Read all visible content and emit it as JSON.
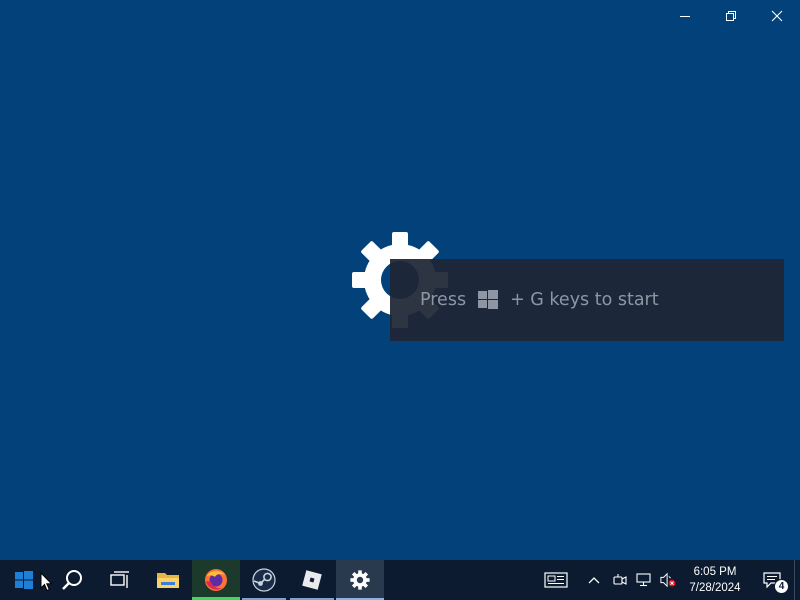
{
  "window": {
    "controls": [
      "minimize",
      "restore",
      "close"
    ]
  },
  "splash": {
    "icon": "gear-icon",
    "hint_prefix": "Press",
    "hint_key_icon": "windows-logo-icon",
    "hint_suffix": "+ G keys to start"
  },
  "taskbar": {
    "start_icon": "windows-start-icon",
    "items": [
      {
        "name": "search",
        "icon": "search-icon"
      },
      {
        "name": "task-view",
        "icon": "task-view-icon"
      },
      {
        "name": "file-explorer",
        "icon": "folder-icon"
      },
      {
        "name": "firefox",
        "icon": "firefox-icon",
        "state": "active"
      },
      {
        "name": "steam",
        "icon": "steam-icon",
        "state": "running"
      },
      {
        "name": "roblox",
        "icon": "roblox-icon",
        "state": "running"
      },
      {
        "name": "settings",
        "icon": "gear-icon",
        "state": "active"
      }
    ],
    "tray": {
      "news_icon": "news-widget-icon",
      "overflow_icon": "chevron-up-icon",
      "meet_icon": "camera-icon",
      "network_icon": "network-icon",
      "volume_icon": "volume-muted-icon",
      "time": "6:05 PM",
      "date": "7/28/2024",
      "notifications_count": "4"
    }
  },
  "colors": {
    "desktop": "#03417a",
    "taskbar": "#0c1b30",
    "firefox_indicator": "#3ed85c"
  }
}
